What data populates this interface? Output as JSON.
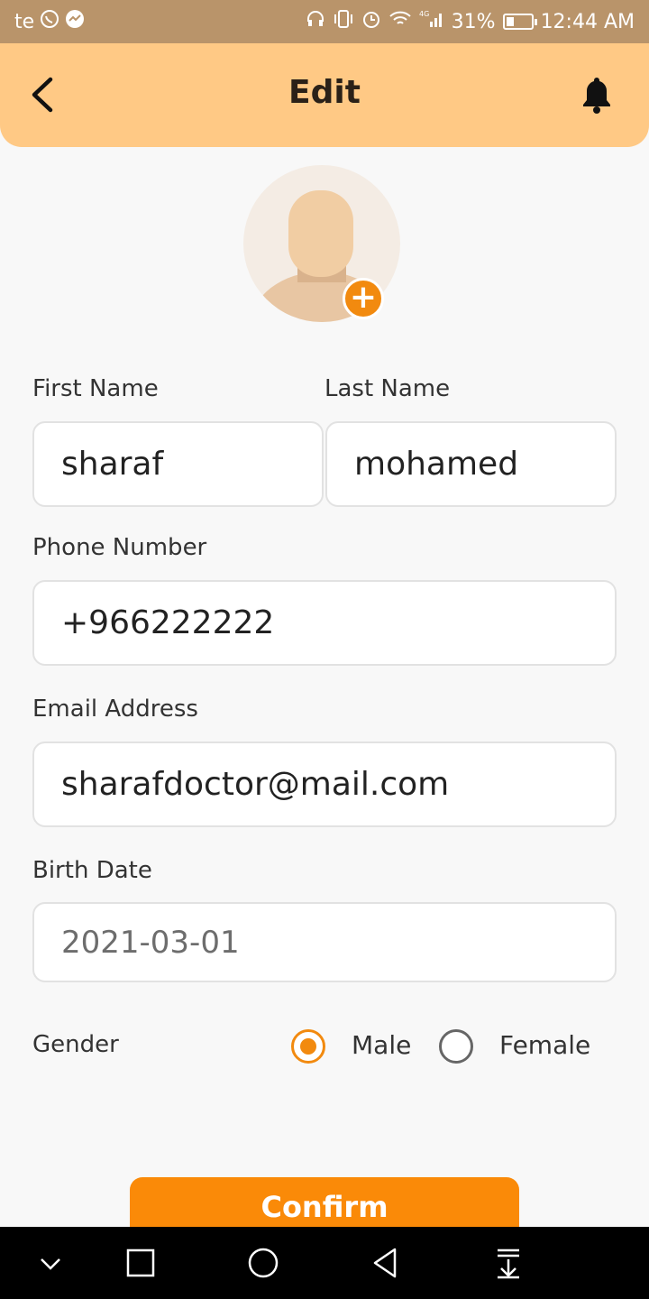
{
  "status_bar": {
    "carrier": "te",
    "battery": "31%",
    "battery_level": 0.31,
    "time": "12:44 AM",
    "network": "4G"
  },
  "header": {
    "title": "Edit"
  },
  "form": {
    "first_name_label": "First Name",
    "first_name_value": "sharaf",
    "last_name_label": "Last Name",
    "last_name_value": "mohamed",
    "phone_label": "Phone Number",
    "phone_value": "+966222222",
    "email_label": "Email Address",
    "email_value": "sharafdoctor@mail.com",
    "birth_label": "Birth Date",
    "birth_value": "2021-03-01",
    "gender_label": "Gender",
    "gender_options": [
      "Male",
      "Female"
    ],
    "gender_selected": "Male"
  },
  "confirm_label": "Confirm",
  "colors": {
    "status_bar": "#b9946a",
    "header": "#ffc985",
    "accent": "#fa8a08"
  },
  "icons": [
    "back-arrow-icon",
    "bell-icon",
    "add-photo-icon",
    "nav-collapse-icon",
    "nav-recents-icon",
    "nav-home-icon",
    "nav-back-icon",
    "nav-notifications-icon"
  ]
}
